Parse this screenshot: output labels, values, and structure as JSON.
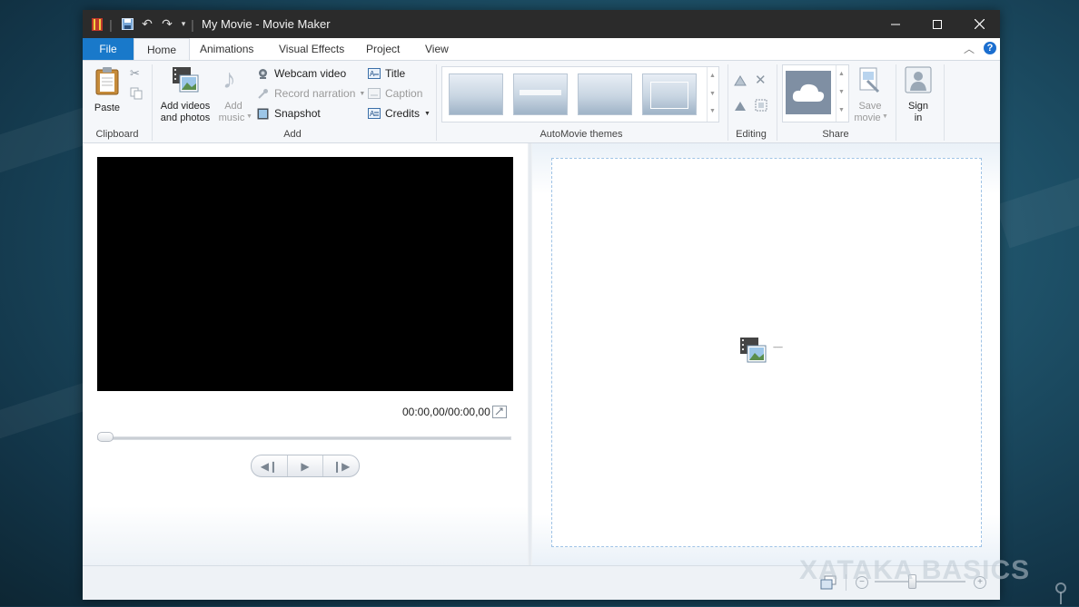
{
  "window": {
    "title": "My Movie - Movie Maker"
  },
  "tabs": {
    "file": "File",
    "home": "Home",
    "animations": "Animations",
    "visual_effects": "Visual Effects",
    "project": "Project",
    "view": "View"
  },
  "help_symbol": "?",
  "ribbon": {
    "clipboard": {
      "paste": "Paste",
      "group": "Clipboard"
    },
    "add": {
      "add_videos_line1": "Add videos",
      "add_videos_line2": "and photos",
      "add_music_line1": "Add",
      "add_music_line2": "music",
      "webcam": "Webcam video",
      "record_narration": "Record narration",
      "snapshot": "Snapshot",
      "title": "Title",
      "caption": "Caption",
      "credits": "Credits",
      "group": "Add"
    },
    "themes": {
      "group": "AutoMovie themes"
    },
    "editing": {
      "group": "Editing"
    },
    "share": {
      "save_movie_line1": "Save",
      "save_movie_line2": "movie",
      "group": "Share"
    },
    "sign_in": {
      "line1": "Sign",
      "line2": "in"
    }
  },
  "player": {
    "timecode": "00:00,00/00:00,00"
  },
  "storyboard": {
    "placeholder_dash": "------"
  },
  "watermark": "XATAKA BASICS",
  "colors": {
    "file_tab": "#1979ca",
    "titlebar": "#2b2b2b",
    "storyboard_border": "#9fc3e6"
  }
}
